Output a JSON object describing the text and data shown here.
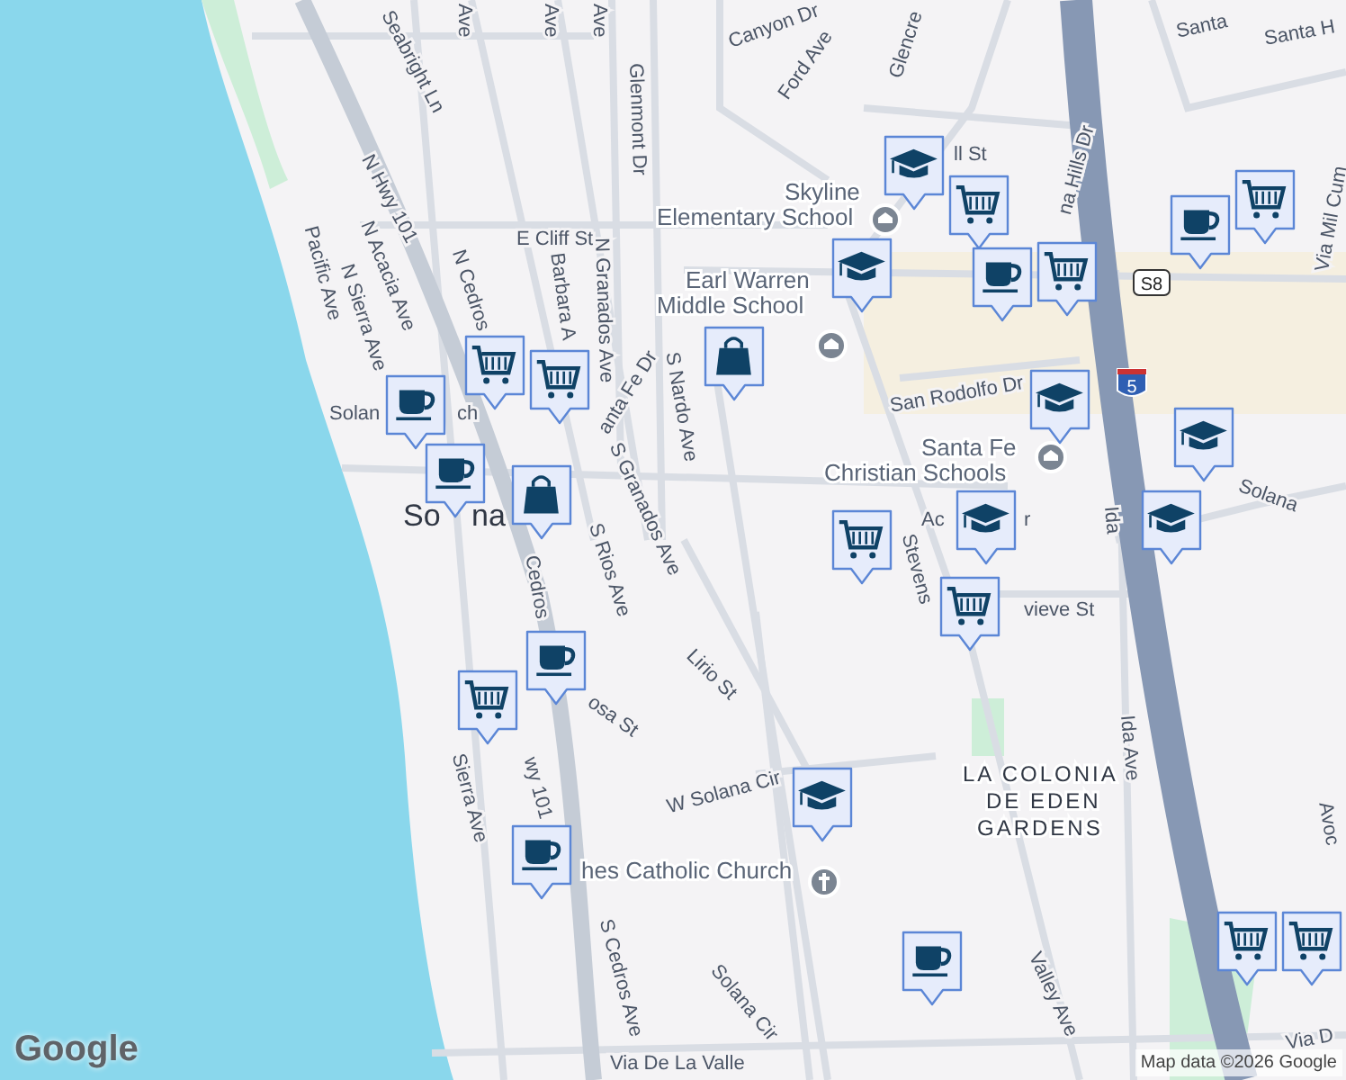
{
  "map": {
    "labels": [
      {
        "kind": "street",
        "text": "Seabright Ln"
      },
      {
        "kind": "street",
        "text": "Ave"
      },
      {
        "kind": "street",
        "text": "Ave"
      },
      {
        "kind": "street",
        "text": "Ave"
      },
      {
        "kind": "street",
        "text": "N Hwy 101"
      },
      {
        "kind": "street",
        "text": "Pacific Ave"
      },
      {
        "kind": "street",
        "text": "N Acacia Ave"
      },
      {
        "kind": "street",
        "text": "N Sierra Ave"
      },
      {
        "kind": "street",
        "text": "N Cedros"
      },
      {
        "kind": "street",
        "text": "E Cliff St"
      },
      {
        "kind": "street",
        "text": "Barbara A"
      },
      {
        "kind": "street",
        "text": "N Granados Ave"
      },
      {
        "kind": "street",
        "text": "Glenmont Dr"
      },
      {
        "kind": "street",
        "text": "Canyon Dr"
      },
      {
        "kind": "street",
        "text": "Ford Ave"
      },
      {
        "kind": "street",
        "text": "Glencre"
      },
      {
        "kind": "street",
        "text": "ll St"
      },
      {
        "kind": "street",
        "text": "na Hills Dr"
      },
      {
        "kind": "street",
        "text": "Santa"
      },
      {
        "kind": "street",
        "text": "Santa H"
      },
      {
        "kind": "street",
        "text": "Via Mil Cum"
      },
      {
        "kind": "poi",
        "text": "Skyline",
        "text2": "Elementary School"
      },
      {
        "kind": "poi",
        "text": "Earl Warren",
        "text2": "Middle School"
      },
      {
        "kind": "poi",
        "text": "Santa Fe",
        "text2": "Christian Schools"
      },
      {
        "kind": "street",
        "text": "San Rodolfo Dr"
      },
      {
        "kind": "street",
        "text": "S Nardo Ave"
      },
      {
        "kind": "street",
        "text": "anta Fe Dr"
      },
      {
        "kind": "street",
        "text": "S Granados Ave"
      },
      {
        "kind": "street",
        "text": "S Rios Ave"
      },
      {
        "kind": "street",
        "text": "Cedros"
      },
      {
        "kind": "street",
        "text": "osa St"
      },
      {
        "kind": "street",
        "text": "Lirio St"
      },
      {
        "kind": "street",
        "text": "Sierra Ave"
      },
      {
        "kind": "street",
        "text": "wy 101"
      },
      {
        "kind": "street",
        "text": "W Solana Cir"
      },
      {
        "kind": "poi",
        "text": "hes Catholic Church"
      },
      {
        "kind": "street",
        "text": "S Cedros Ave"
      },
      {
        "kind": "street",
        "text": "Solana Cir"
      },
      {
        "kind": "street",
        "text": "Via De La Valle"
      },
      {
        "kind": "street",
        "text": "Valley Ave"
      },
      {
        "kind": "street",
        "text": "Ida"
      },
      {
        "kind": "street",
        "text": "Ida Ave"
      },
      {
        "kind": "street",
        "text": "Solana"
      },
      {
        "kind": "street",
        "text": "Avoc"
      },
      {
        "kind": "street",
        "text": "Stevens"
      },
      {
        "kind": "street",
        "text": "vieve St"
      },
      {
        "kind": "street",
        "text": "Ac"
      },
      {
        "kind": "street",
        "text": "r"
      },
      {
        "kind": "area",
        "text": "LA COLONIA",
        "text2": "DE EDEN",
        "text3": "GARDENS"
      },
      {
        "kind": "place",
        "text": "Solan"
      },
      {
        "kind": "place",
        "text": "ch"
      },
      {
        "kind": "city",
        "text": "So"
      },
      {
        "kind": "city",
        "text": "na"
      },
      {
        "kind": "street",
        "text": "Via D"
      }
    ],
    "shields": [
      {
        "kind": "county",
        "text": "S8"
      },
      {
        "kind": "interstate",
        "text": "5"
      }
    ],
    "markers": [
      {
        "kind": "school"
      },
      {
        "kind": "cart"
      },
      {
        "kind": "cafe"
      },
      {
        "kind": "cart"
      },
      {
        "kind": "school"
      },
      {
        "kind": "cart"
      },
      {
        "kind": "cafe"
      },
      {
        "kind": "bag"
      },
      {
        "kind": "school"
      },
      {
        "kind": "school"
      },
      {
        "kind": "school"
      },
      {
        "kind": "cart"
      },
      {
        "kind": "school"
      },
      {
        "kind": "cart"
      },
      {
        "kind": "cart"
      },
      {
        "kind": "cart"
      },
      {
        "kind": "cafe"
      },
      {
        "kind": "cafe"
      },
      {
        "kind": "bag"
      },
      {
        "kind": "cafe"
      },
      {
        "kind": "cart"
      },
      {
        "kind": "cafe"
      },
      {
        "kind": "school"
      },
      {
        "kind": "cafe"
      },
      {
        "kind": "cart"
      },
      {
        "kind": "cart"
      }
    ],
    "logo": "Google",
    "attribution": "Map data ©2026 Google"
  }
}
